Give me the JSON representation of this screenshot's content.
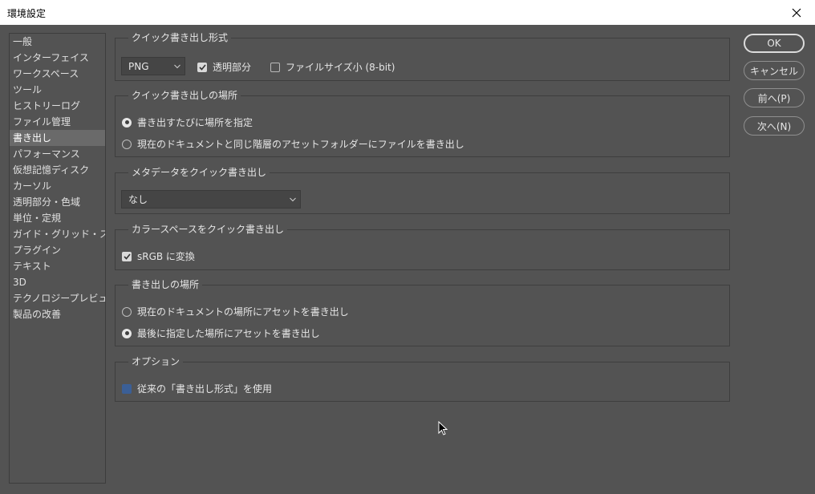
{
  "window": {
    "title": "環境設定"
  },
  "sidebar": {
    "items": [
      {
        "label": "一般"
      },
      {
        "label": "インターフェイス"
      },
      {
        "label": "ワークスペース"
      },
      {
        "label": "ツール"
      },
      {
        "label": "ヒストリーログ"
      },
      {
        "label": "ファイル管理"
      },
      {
        "label": "書き出し",
        "selected": true
      },
      {
        "label": "パフォーマンス"
      },
      {
        "label": "仮想記憶ディスク"
      },
      {
        "label": "カーソル"
      },
      {
        "label": "透明部分・色域"
      },
      {
        "label": "単位・定規"
      },
      {
        "label": "ガイド・グリッド・スライス"
      },
      {
        "label": "プラグイン"
      },
      {
        "label": "テキスト"
      },
      {
        "label": "3D"
      },
      {
        "label": "テクノロジープレビュー"
      },
      {
        "label": "製品の改善"
      }
    ]
  },
  "quick_export_format": {
    "title": "クイック書き出し形式",
    "format_value": "PNG",
    "transparency_label": "透明部分",
    "transparency_checked": true,
    "smaller_file_label": "ファイルサイズ小 (8-bit)",
    "smaller_file_checked": false
  },
  "quick_export_location": {
    "title": "クイック書き出しの場所",
    "option1": "書き出すたびに場所を指定",
    "option2": "現在のドキュメントと同じ階層のアセットフォルダーにファイルを書き出し",
    "selected": 1
  },
  "metadata": {
    "title": "メタデータをクイック書き出し",
    "value": "なし"
  },
  "color_space": {
    "title": "カラースペースをクイック書き出し",
    "srgb_label": "sRGB に変換",
    "srgb_checked": true
  },
  "export_location": {
    "title": "書き出しの場所",
    "option1": "現在のドキュメントの場所にアセットを書き出し",
    "option2": "最後に指定した場所にアセットを書き出し",
    "selected": 2
  },
  "options": {
    "title": "オプション",
    "legacy_label": "従来の「書き出し形式」を使用",
    "legacy_checked": false
  },
  "buttons": {
    "ok": "OK",
    "cancel": "キャンセル",
    "prev": "前へ(P)",
    "next": "次へ(N)"
  }
}
